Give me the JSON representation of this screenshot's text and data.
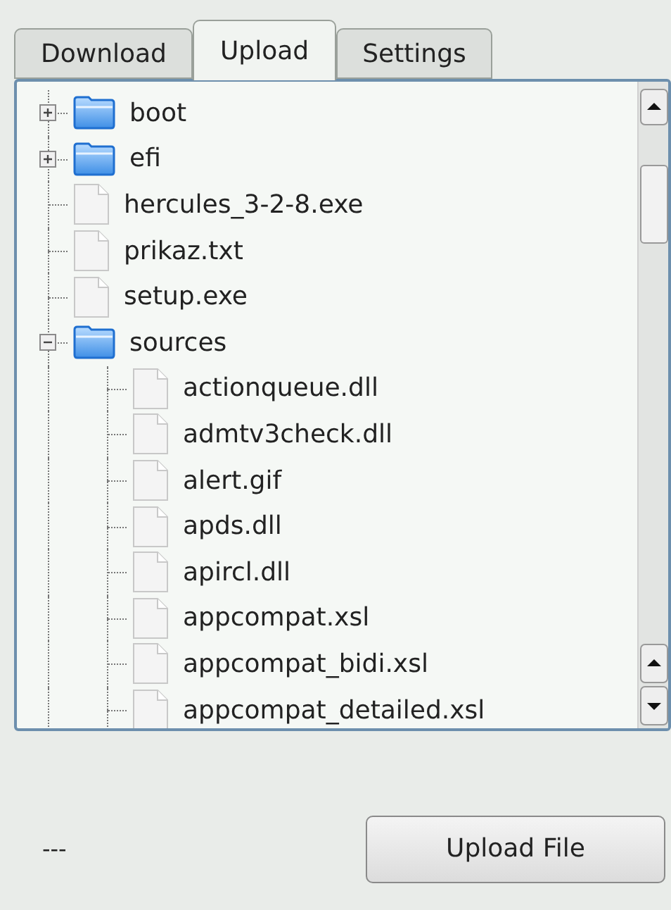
{
  "tabs": [
    {
      "label": "Download",
      "selected": false
    },
    {
      "label": "Upload",
      "selected": true
    },
    {
      "label": "Settings",
      "selected": false
    }
  ],
  "tree": [
    {
      "name": "boot",
      "kind": "folder",
      "expanded": false
    },
    {
      "name": "efi",
      "kind": "folder",
      "expanded": false
    },
    {
      "name": "hercules_3-2-8.exe",
      "kind": "file"
    },
    {
      "name": "prikaz.txt",
      "kind": "file"
    },
    {
      "name": "setup.exe",
      "kind": "file"
    },
    {
      "name": "sources",
      "kind": "folder",
      "expanded": true,
      "children": [
        {
          "name": "actionqueue.dll",
          "kind": "file"
        },
        {
          "name": "admtv3check.dll",
          "kind": "file"
        },
        {
          "name": "alert.gif",
          "kind": "file"
        },
        {
          "name": "apds.dll",
          "kind": "file"
        },
        {
          "name": "apircl.dll",
          "kind": "file"
        },
        {
          "name": "appcompat.xsl",
          "kind": "file"
        },
        {
          "name": "appcompat_bidi.xsl",
          "kind": "file"
        },
        {
          "name": "appcompat_detailed.xsl",
          "kind": "file"
        }
      ]
    }
  ],
  "status": "---",
  "upload_button": "Upload File"
}
